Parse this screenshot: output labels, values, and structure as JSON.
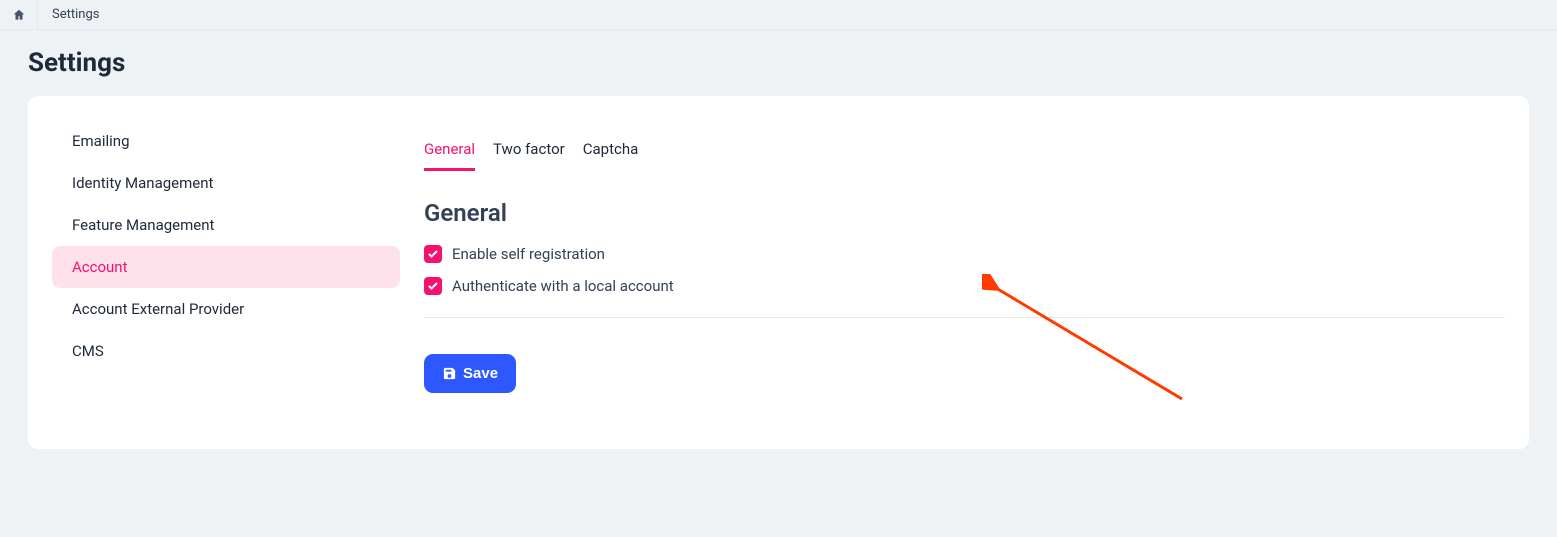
{
  "breadcrumb": {
    "current": "Settings"
  },
  "page": {
    "title": "Settings"
  },
  "sidebar": {
    "items": [
      {
        "label": "Emailing",
        "active": false
      },
      {
        "label": "Identity Management",
        "active": false
      },
      {
        "label": "Feature Management",
        "active": false
      },
      {
        "label": "Account",
        "active": true
      },
      {
        "label": "Account External Provider",
        "active": false
      },
      {
        "label": "CMS",
        "active": false
      }
    ]
  },
  "tabs": [
    {
      "label": "General",
      "active": true
    },
    {
      "label": "Two factor",
      "active": false
    },
    {
      "label": "Captcha",
      "active": false
    }
  ],
  "section": {
    "title": "General",
    "checks": [
      {
        "label": "Enable self registration",
        "checked": true
      },
      {
        "label": "Authenticate with a local account",
        "checked": true
      }
    ]
  },
  "buttons": {
    "save": "Save"
  }
}
